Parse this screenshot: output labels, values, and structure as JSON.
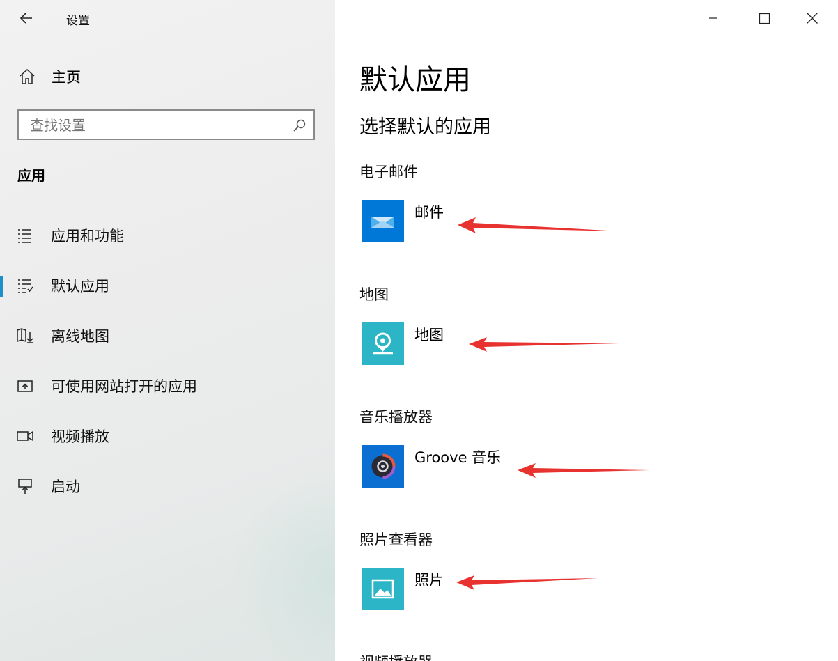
{
  "window": {
    "title": "设置",
    "accent": "#0078d7"
  },
  "sidebar": {
    "home_label": "主页",
    "search_placeholder": "查找设置",
    "section_heading": "应用",
    "items": [
      {
        "label": "应用和功能",
        "icon": "apps-features-icon"
      },
      {
        "label": "默认应用",
        "icon": "default-apps-icon",
        "selected": true
      },
      {
        "label": "离线地图",
        "icon": "offline-maps-icon"
      },
      {
        "label": "可使用网站打开的应用",
        "icon": "apps-for-websites-icon"
      },
      {
        "label": "视频播放",
        "icon": "video-playback-icon"
      },
      {
        "label": "启动",
        "icon": "startup-icon"
      }
    ]
  },
  "main": {
    "page_title": "默认应用",
    "subtitle": "选择默认的应用",
    "categories": [
      {
        "label": "电子邮件",
        "app": "邮件",
        "icon": "mail-app-icon",
        "tile_color": "#0078d7"
      },
      {
        "label": "地图",
        "app": "地图",
        "icon": "maps-app-icon",
        "tile_color": "#2bb5c6"
      },
      {
        "label": "音乐播放器",
        "app": "Groove 音乐",
        "icon": "groove-music-app-icon",
        "tile_color": "#0a6fd1"
      },
      {
        "label": "照片查看器",
        "app": "照片",
        "icon": "photos-app-icon",
        "tile_color": "#2bb5c6"
      },
      {
        "label": "视频播放器"
      }
    ]
  },
  "annotation_color": "#e8322f"
}
